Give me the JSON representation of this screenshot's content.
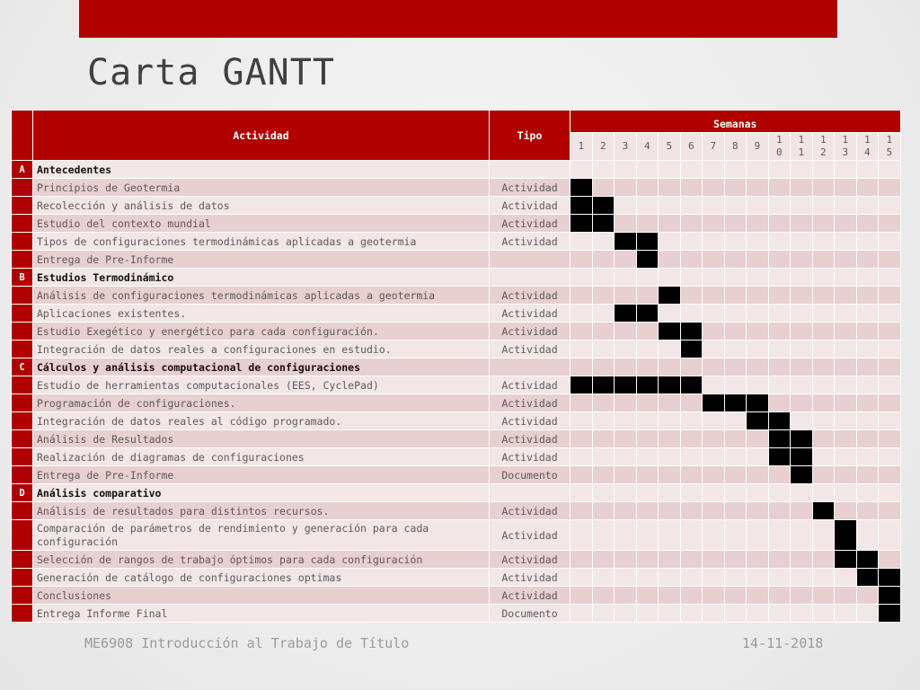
{
  "slide": {
    "title": "Carta GANTT"
  },
  "table": {
    "header_actividad": "Actividad",
    "header_tipo": "Tipo",
    "header_semanas": "Semanas",
    "weeks": [
      "1",
      "2",
      "3",
      "4",
      "5",
      "6",
      "7",
      "8",
      "9",
      "10",
      "11",
      "12",
      "13",
      "14",
      "15"
    ],
    "rows": [
      {
        "code": "A",
        "label": "Antecedentes",
        "tipo": "",
        "section": true,
        "weeks": []
      },
      {
        "code": "",
        "label": "Principios de Geotermia",
        "tipo": "Actividad",
        "weeks": [
          1
        ]
      },
      {
        "code": "",
        "label": "Recolección y análisis de datos",
        "tipo": "Actividad",
        "weeks": [
          1,
          2
        ]
      },
      {
        "code": "",
        "label": "Estudio del contexto mundial",
        "tipo": "Actividad",
        "weeks": [
          1,
          2
        ]
      },
      {
        "code": "",
        "label": "Tipos de configuraciones termodinámicas aplicadas a geotermia",
        "tipo": "Actividad",
        "weeks": [
          3,
          4
        ]
      },
      {
        "code": "",
        "label": "Entrega de Pre-Informe",
        "tipo": "",
        "weeks": [
          4
        ]
      },
      {
        "code": "B",
        "label": "Estudios Termodinámico",
        "tipo": "",
        "section": true,
        "weeks": []
      },
      {
        "code": "",
        "label": "Análisis de configuraciones termodinámicas aplicadas a geotermia",
        "tipo": "Actividad",
        "weeks": [
          5
        ]
      },
      {
        "code": "",
        "label": "Aplicaciones existentes.",
        "tipo": "Actividad",
        "weeks": [
          3,
          4
        ]
      },
      {
        "code": "",
        "label": "Estudio Exegético y energético para cada configuración.",
        "tipo": "Actividad",
        "weeks": [
          5,
          6
        ]
      },
      {
        "code": "",
        "label": "Integración de datos reales a configuraciones en estudio.",
        "tipo": "Actividad",
        "weeks": [
          6
        ]
      },
      {
        "code": "C",
        "label": "Cálculos y análisis computacional de configuraciones",
        "tipo": "",
        "section": true,
        "weeks": []
      },
      {
        "code": "",
        "label": "Estudio de herramientas computacionales (EES, CyclePad)",
        "tipo": "Actividad",
        "weeks": [
          1,
          2,
          3,
          4,
          5,
          6
        ]
      },
      {
        "code": "",
        "label": "Programación de configuraciones.",
        "tipo": "Actividad",
        "weeks": [
          7,
          8,
          9
        ]
      },
      {
        "code": "",
        "label": "Integración de datos reales al código programado.",
        "tipo": "Actividad",
        "weeks": [
          9,
          10
        ]
      },
      {
        "code": "",
        "label": "Análisis de Resultados",
        "tipo": "Actividad",
        "weeks": [
          10,
          11
        ]
      },
      {
        "code": "",
        "label": "Realización de diagramas de configuraciones",
        "tipo": "Actividad",
        "weeks": [
          10,
          11
        ]
      },
      {
        "code": "",
        "label": "Entrega de Pre-Informe",
        "tipo": "Documento",
        "weeks": [
          11
        ]
      },
      {
        "code": "D",
        "label": "Análisis comparativo",
        "tipo": "",
        "section": true,
        "weeks": []
      },
      {
        "code": "",
        "label": "Análisis de resultados para distintos recursos.",
        "tipo": "Actividad",
        "weeks": [
          12
        ]
      },
      {
        "code": "",
        "label": "Comparación de parámetros de rendimiento y generación para cada configuración",
        "tipo": "Actividad",
        "tall": true,
        "weeks": [
          13
        ]
      },
      {
        "code": "",
        "label": "Selección de rangos de trabajo óptimos para cada configuración",
        "tipo": "Actividad",
        "weeks": [
          13,
          14
        ]
      },
      {
        "code": "",
        "label": "Generación de catálogo de configuraciones optimas",
        "tipo": "Actividad",
        "weeks": [
          14,
          15
        ]
      },
      {
        "code": "",
        "label": "Conclusiones",
        "tipo": "Actividad",
        "weeks": [
          15
        ]
      },
      {
        "code": "",
        "label": "Entrega Informe Final",
        "tipo": "Documento",
        "weeks": [
          15
        ]
      }
    ]
  },
  "footer": {
    "course": "ME6908 Introducción al Trabajo de Título",
    "date": "14-11-2018"
  },
  "colors": {
    "accent": "#b00000",
    "row_dark": "#e8cfd0",
    "row_light": "#f3e6e6",
    "bar": "#000000"
  }
}
